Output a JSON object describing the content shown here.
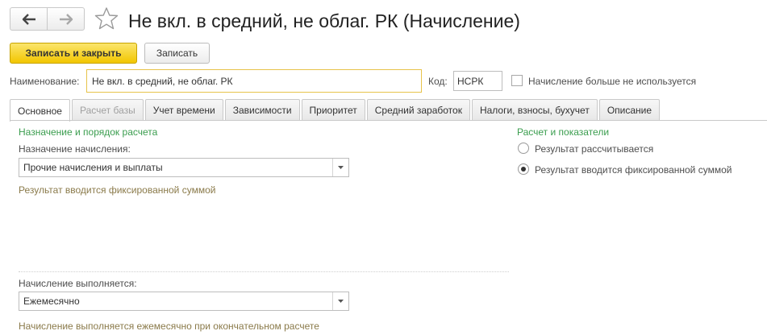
{
  "header": {
    "title": "Не вкл. в средний, не облаг. РК (Начисление)",
    "back_icon": "arrow-left-icon",
    "forward_icon": "arrow-right-icon",
    "favorite_icon": "star-icon"
  },
  "toolbar": {
    "save_close_label": "Записать и закрыть",
    "save_label": "Записать"
  },
  "form": {
    "name_label": "Наименование:",
    "name_value": "Не вкл. в средний, не облаг. РК",
    "code_label": "Код:",
    "code_value": "НСРК",
    "unused_label": "Начисление больше не используется",
    "unused_checked": false
  },
  "tabs": [
    {
      "label": "Основное",
      "active": true
    },
    {
      "label": "Расчет базы",
      "disabled": true
    },
    {
      "label": "Учет времени"
    },
    {
      "label": "Зависимости"
    },
    {
      "label": "Приоритет"
    },
    {
      "label": "Средний заработок"
    },
    {
      "label": "Налоги, взносы, бухучет"
    },
    {
      "label": "Описание"
    }
  ],
  "main": {
    "section_title": "Назначение и порядок расчета",
    "assignment_label": "Назначение начисления:",
    "assignment_value": "Прочие начисления и выплаты",
    "assignment_hint": "Результат вводится фиксированной суммой",
    "execution_label": "Начисление выполняется:",
    "execution_value": "Ежемесячно",
    "execution_hint": "Начисление выполняется ежемесячно при окончательном расчете"
  },
  "side": {
    "section_title": "Расчет и показатели",
    "options": [
      {
        "label": "Результат рассчитывается",
        "selected": false
      },
      {
        "label": "Результат вводится фиксированной суммой",
        "selected": true
      }
    ]
  },
  "colors": {
    "accent_yellow": "#f2c600",
    "section_green": "#3a9d4e",
    "hint_color": "#8a7a4a",
    "focus_border": "#e7c34a"
  }
}
